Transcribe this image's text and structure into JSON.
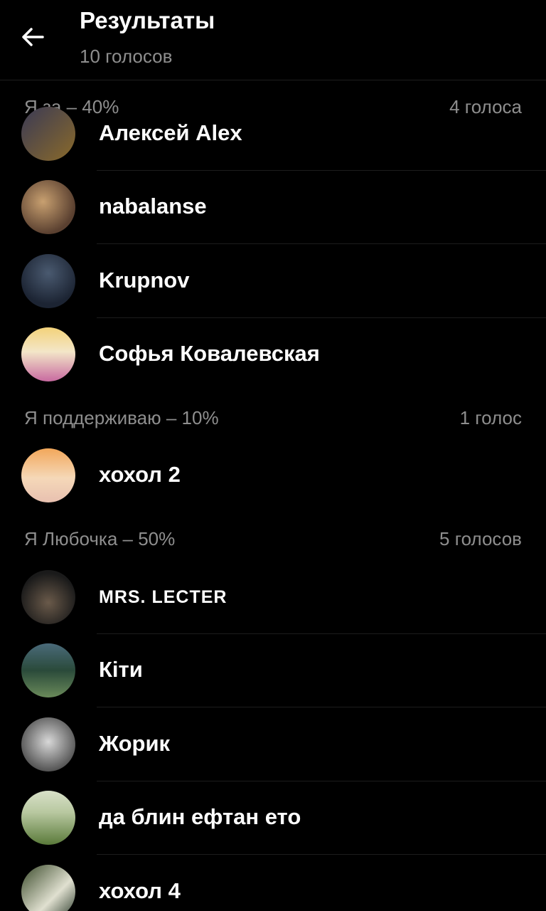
{
  "header": {
    "title": "Результаты",
    "subtitle": "10 голосов",
    "back_icon": "arrow-left-icon"
  },
  "sections": [
    {
      "label": "Я за – 40%",
      "count": "4 голоса",
      "voters": [
        {
          "name": "Алексей Alex",
          "avatar_colors": [
            "#3a3a55",
            "#8a6a2a"
          ]
        },
        {
          "name": "nabalanse",
          "avatar_colors": [
            "#5a4030",
            "#c8a070"
          ]
        },
        {
          "name": "Krupnov",
          "avatar_colors": [
            "#1c2433",
            "#4a5a70"
          ]
        },
        {
          "name": "Софья Ковалевская",
          "avatar_colors": [
            "#f3d27a",
            "#c86aa0"
          ]
        }
      ]
    },
    {
      "label": "Я поддерживаю – 10%",
      "count": "1 голос",
      "voters": [
        {
          "name": "хохол 2",
          "avatar_colors": [
            "#f2a75a",
            "#e8c0b0"
          ]
        }
      ]
    },
    {
      "label": "Я Любочка – 50%",
      "count": "5 голосов",
      "voters": [
        {
          "name": "MRS. LECTER",
          "avatar_colors": [
            "#1a1a1a",
            "#6a5a4a"
          ]
        },
        {
          "name": "Кіти",
          "avatar_colors": [
            "#2a4a3a",
            "#6a8a5a"
          ]
        },
        {
          "name": "Жорик",
          "avatar_colors": [
            "#d8d8d8",
            "#505050"
          ]
        },
        {
          "name": "да блин ефтан ето",
          "avatar_colors": [
            "#b8c8a0",
            "#5a7a3a"
          ]
        },
        {
          "name": "хохол 4",
          "avatar_colors": [
            "#3a4a2a",
            "#e0e0d0"
          ]
        }
      ]
    }
  ]
}
